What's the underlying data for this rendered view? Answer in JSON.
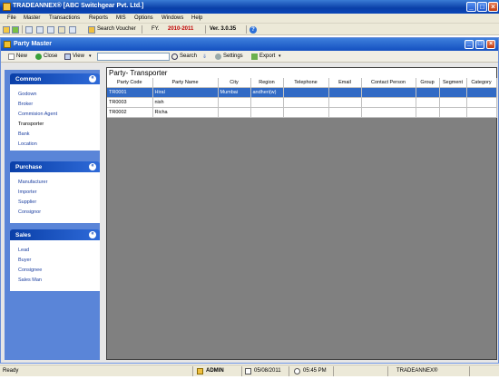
{
  "app": {
    "title": "TRADEANNEX® [ABC Switchgear Pvt. Ltd.]"
  },
  "menu": [
    "File",
    "Master",
    "Transactions",
    "Reports",
    "MIS",
    "Options",
    "Windows",
    "Help"
  ],
  "toolbar": {
    "search_voucher": "Search Voucher",
    "fy_label": "FY.",
    "fy_value": "2010-2011",
    "version": "Ver. 3.0.35"
  },
  "child": {
    "title": "Party Master",
    "toolbar": {
      "new": "New",
      "close": "Close",
      "view": "View",
      "search_placeholder": "",
      "search": "Search",
      "settings": "Settings",
      "export": "Export"
    }
  },
  "nav": {
    "groups": [
      {
        "title": "Common",
        "items": [
          "Godown",
          "Broker",
          "Commision Agent",
          "Transporter",
          "Bank",
          "Location"
        ]
      },
      {
        "title": "Purchase",
        "items": [
          "Manufacturer",
          "Importer",
          "Supplier",
          "Consignor"
        ]
      },
      {
        "title": "Sales",
        "items": [
          "Lead",
          "Buyer",
          "Consignee",
          "Sales Man"
        ]
      }
    ]
  },
  "content": {
    "title": "Party- Transporter",
    "columns": [
      "Party Code",
      "Party Name",
      "City",
      "Region",
      "Telephone",
      "Email",
      "Contact Person",
      "Group",
      "Segment",
      "Category"
    ],
    "rows": [
      [
        "TR0001",
        "Hiral",
        "Mumbai",
        "andheri(w)",
        "",
        "",
        "",
        "",
        "",
        ""
      ],
      [
        "TR0003",
        "nish",
        "",
        "",
        "",
        "",
        "",
        "",
        "",
        ""
      ],
      [
        "TR0002",
        "Richa",
        "",
        "",
        "",
        "",
        "",
        "",
        "",
        ""
      ]
    ]
  },
  "status": {
    "ready": "Ready",
    "user": "ADMIN",
    "date": "05/08/2011",
    "time": "05:45 PM",
    "brand": "TRADEANNEX®"
  }
}
